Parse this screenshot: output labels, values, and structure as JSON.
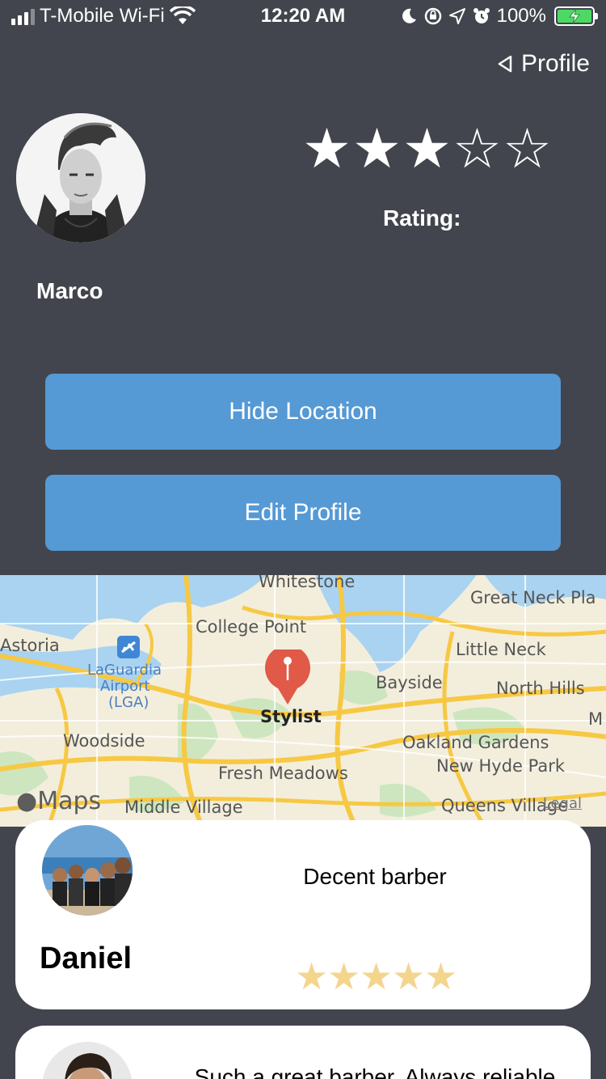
{
  "status_bar": {
    "carrier": "T-Mobile Wi-Fi",
    "time": "12:20 AM",
    "battery": "100%",
    "icons": [
      "signal-icon",
      "wifi-icon",
      "moon-icon",
      "orientation-lock-icon",
      "location-icon",
      "alarm-icon",
      "battery-charging-icon"
    ]
  },
  "header": {
    "back_label": "Profile"
  },
  "profile": {
    "name": "Marco",
    "rating_label": "Rating:",
    "rating_stars": 3,
    "rating_max": 5
  },
  "actions": {
    "hide_location_label": "Hide Location",
    "edit_profile_label": "Edit Profile"
  },
  "map": {
    "pin_label": "Stylist",
    "brand": "Maps",
    "legal": "Legal",
    "places": [
      "Whitestone",
      "Great Neck Pla",
      "College Point",
      "Astoria",
      "LaGuardia",
      "Airport",
      "(LGA)",
      "Little Neck",
      "Bayside",
      "North Hills",
      "M",
      "Woodside",
      "Oakland Gardens",
      "New Hyde Park",
      "Fresh Meadows",
      "Middle Village",
      "Queens Village"
    ]
  },
  "reviews": [
    {
      "name": "Daniel",
      "text": "Decent barber",
      "stars": 5
    },
    {
      "name": "",
      "text": "Such a great barber. Always reliable",
      "stars": null
    }
  ],
  "colors": {
    "background": "#42454d",
    "button": "#5599d5",
    "review_star": "#f3d58e",
    "map_pin": "#e05a47"
  }
}
